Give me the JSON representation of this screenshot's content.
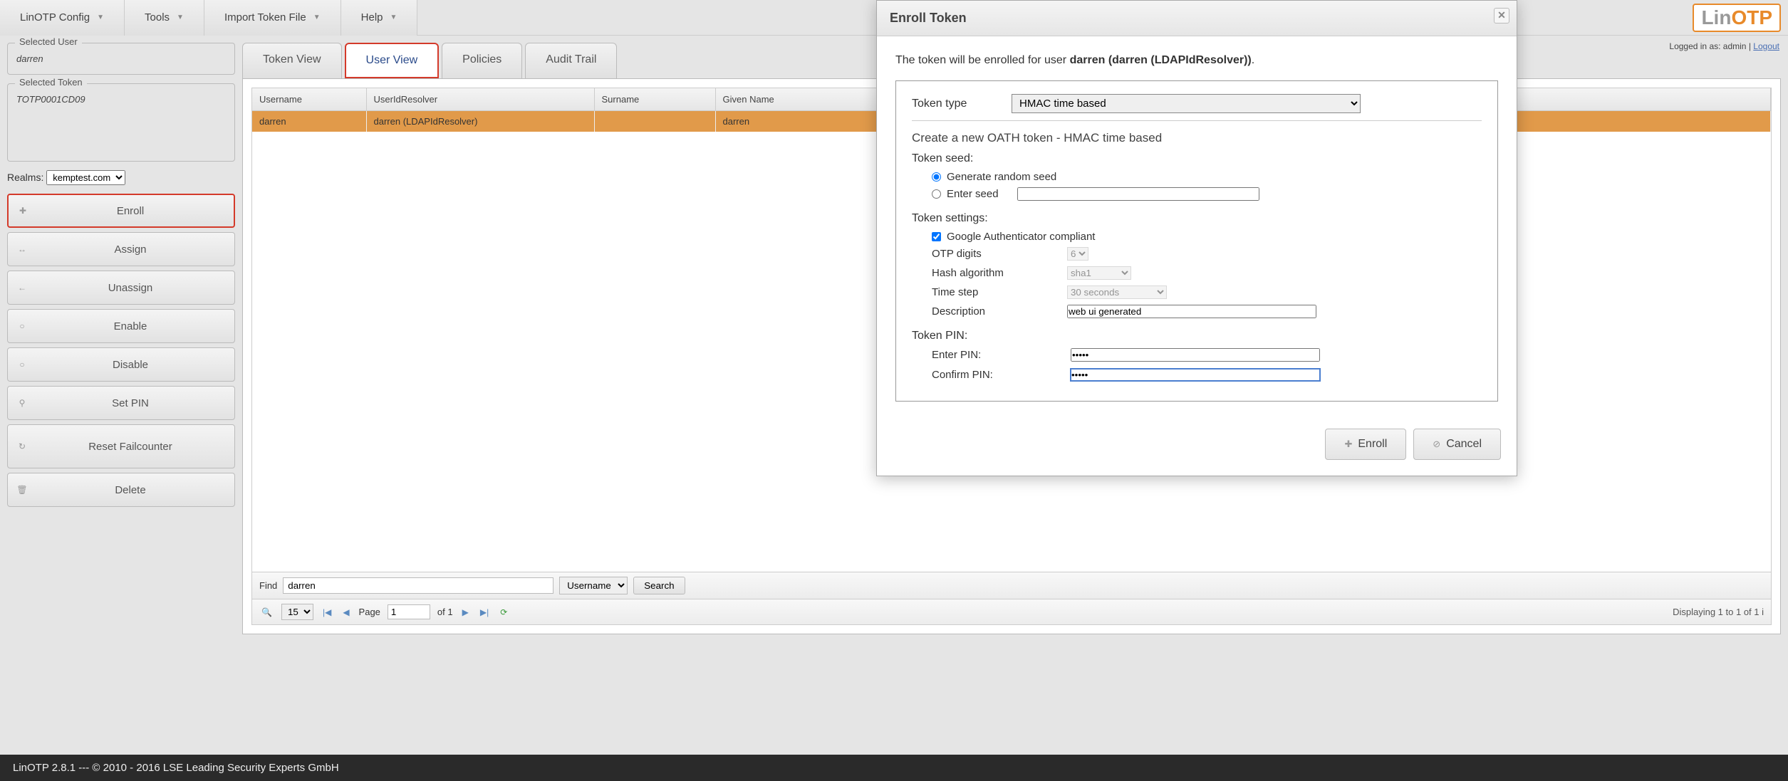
{
  "menu": {
    "config": "LinOTP Config",
    "tools": "Tools",
    "import": "Import Token File",
    "help": "Help"
  },
  "brand": {
    "lin": "Lin",
    "otp": "OTP"
  },
  "login_info": {
    "prefix": "Logged in as:",
    "user": "admin",
    "sep": "|",
    "logout": "Logout"
  },
  "sidebar": {
    "selected_user_legend": "Selected User",
    "selected_user_value": "darren",
    "selected_token_legend": "Selected Token",
    "selected_token_value": "TOTP0001CD09",
    "realms_label": "Realms:",
    "realms_value": "kemptest.com",
    "buttons": {
      "enroll": "Enroll",
      "assign": "Assign",
      "unassign": "Unassign",
      "enable": "Enable",
      "disable": "Disable",
      "setpin": "Set PIN",
      "reset": "Reset Failcounter",
      "delete": "Delete"
    }
  },
  "tabs": {
    "token": "Token View",
    "user": "User View",
    "policies": "Policies",
    "audit": "Audit Trail"
  },
  "table": {
    "columns": {
      "username": "Username",
      "resolver": "UserIdResolver",
      "surname": "Surname",
      "given": "Given Name"
    },
    "rows": [
      {
        "username": "darren",
        "resolver": "darren (LDAPIdResolver)",
        "surname": "",
        "given": "darren"
      }
    ],
    "find_label": "Find",
    "find_value": "darren",
    "find_field": "Username",
    "search_btn": "Search",
    "pager": {
      "per_page": "15",
      "page_label": "Page",
      "page_value": "1",
      "of_label": "of 1",
      "info": "Displaying 1 to 1 of 1 i"
    }
  },
  "dialog": {
    "title": "Enroll Token",
    "intro_pre": "The token will be enrolled for user ",
    "intro_user": "darren (darren (LDAPIdResolver))",
    "intro_post": ".",
    "token_type_label": "Token type",
    "token_type_value": "HMAC time based",
    "create_heading": "Create a new OATH token - HMAC time based",
    "seed_heading": "Token seed:",
    "seed_generate": "Generate random seed",
    "seed_enter": "Enter seed",
    "settings_heading": "Token settings:",
    "google_compliant": "Google Authenticator compliant",
    "otp_digits_label": "OTP digits",
    "otp_digits_value": "6",
    "hash_label": "Hash algorithm",
    "hash_value": "sha1",
    "timestep_label": "Time step",
    "timestep_value": "30 seconds",
    "desc_label": "Description",
    "desc_value": "web ui generated",
    "pin_heading": "Token PIN:",
    "enter_pin_label": "Enter PIN:",
    "confirm_pin_label": "Confirm PIN:",
    "pin_value": "•••••",
    "actions": {
      "enroll": "Enroll",
      "cancel": "Cancel"
    }
  },
  "footer": "LinOTP 2.8.1 --- © 2010 - 2016 LSE Leading Security Experts GmbH"
}
